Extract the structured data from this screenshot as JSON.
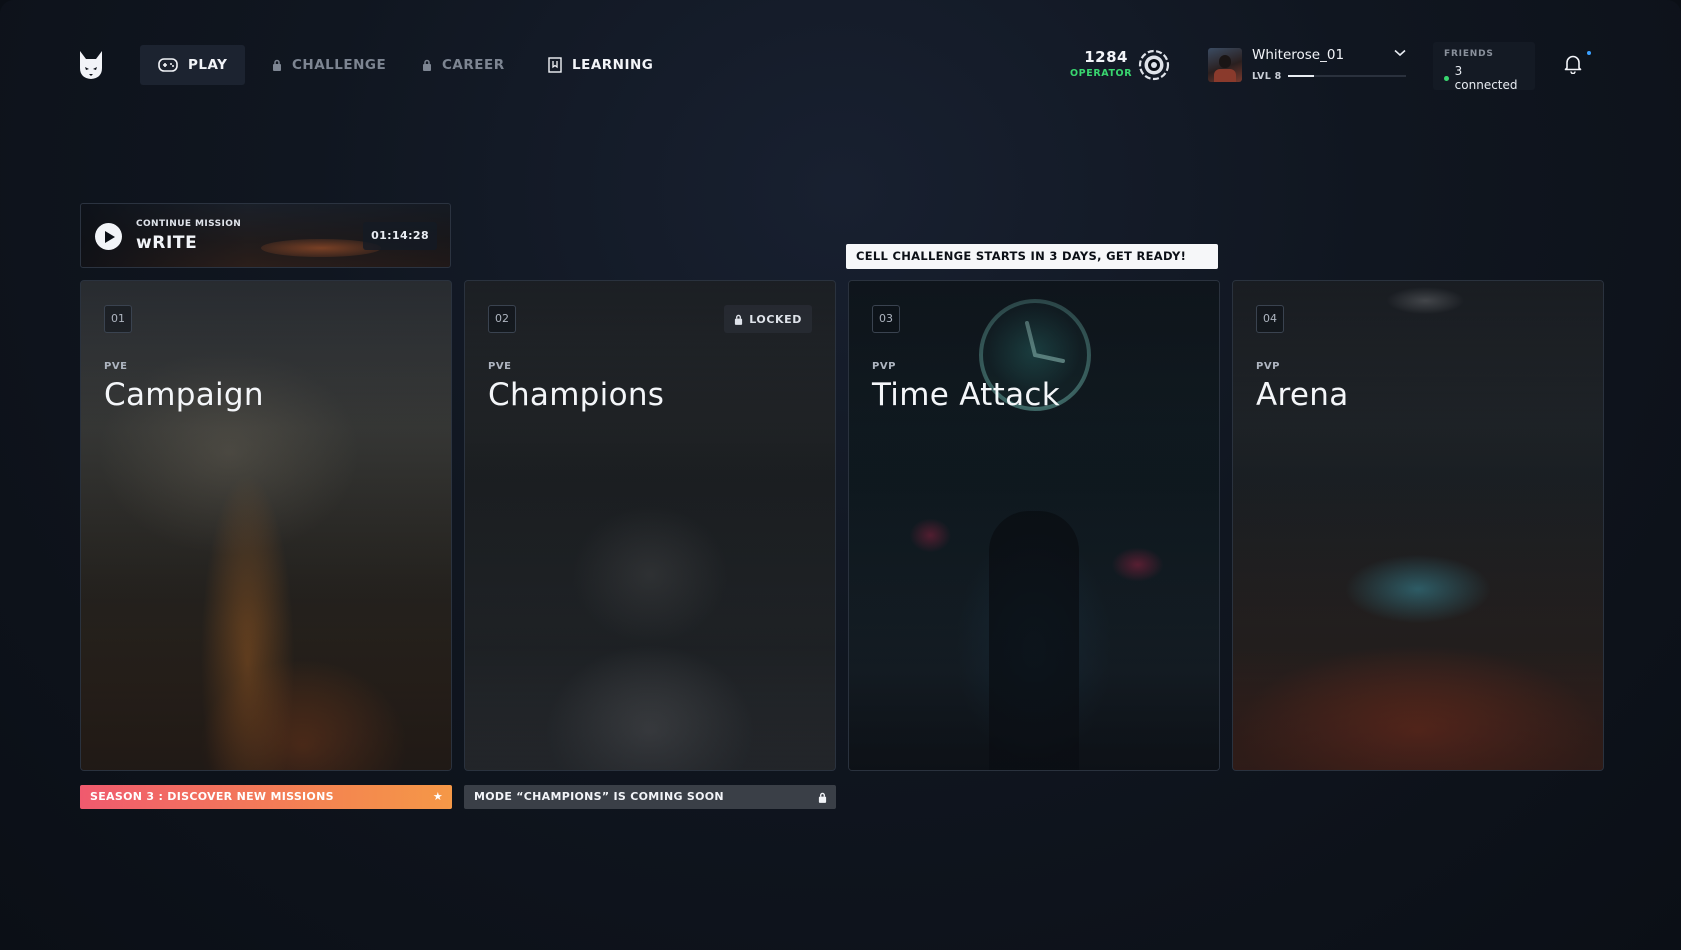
{
  "nav": {
    "logo": "fox-logo",
    "tabs": [
      {
        "label": "PLAY",
        "icon": "gamepad-icon",
        "active": true
      },
      {
        "label": "CHALLENGE",
        "icon": "lock-icon",
        "active": false
      },
      {
        "label": "CAREER",
        "icon": "lock-icon",
        "active": false
      },
      {
        "label": "LEARNING",
        "icon": "bookmark-icon",
        "active": false
      }
    ]
  },
  "player": {
    "score": "1284",
    "rank": "OPERATOR",
    "badge": "rank-badge-icon",
    "username": "Whiterose_01",
    "level": "LVL 8",
    "xp_fraction": 0.22
  },
  "friends": {
    "label": "FRIENDS",
    "connected": "3 connected"
  },
  "notifications": {
    "icon": "bell-icon",
    "unread": true
  },
  "continue_mission": {
    "label": "CONTINUE MISSION",
    "title": "wRITE",
    "time": "01:14:28"
  },
  "banner": "CELL CHALLENGE STARTS IN 3 DAYS, GET READY!",
  "cards": [
    {
      "number": "01",
      "mode": "PVE",
      "title": "Campaign"
    },
    {
      "number": "02",
      "mode": "PVE",
      "title": "Champions",
      "locked_label": "LOCKED"
    },
    {
      "number": "03",
      "mode": "PVP",
      "title": "Time Attack"
    },
    {
      "number": "04",
      "mode": "PVP",
      "title": "Arena"
    }
  ],
  "footers": {
    "season": "SEASON 3 : DISCOVER NEW MISSIONS",
    "champions": "MODE “CHAMPIONS” IS COMING SOON"
  },
  "colors": {
    "accent_green": "#39d66f",
    "season_gradient_start": "#f05a6e",
    "season_gradient_end": "#f59847",
    "notification_dot": "#3aa0ff"
  }
}
